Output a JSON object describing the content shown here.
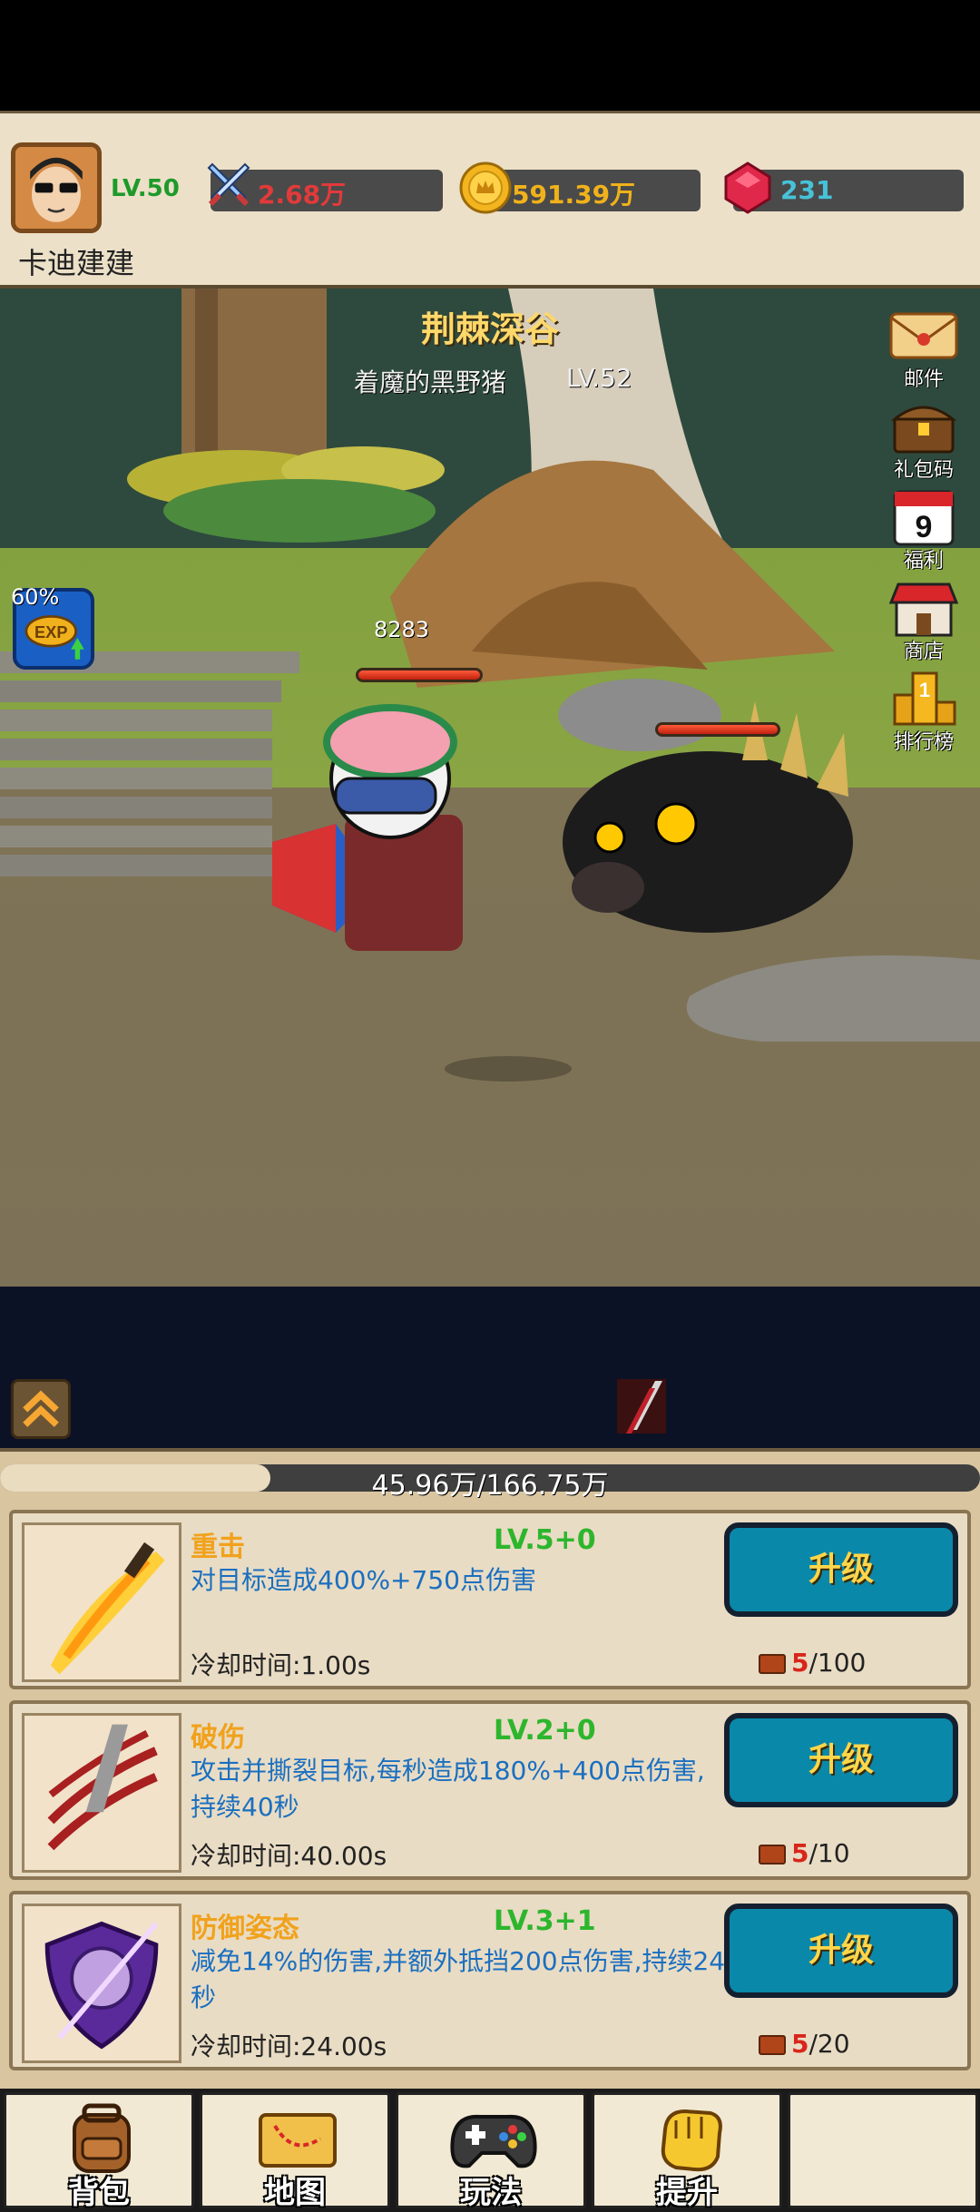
{
  "player": {
    "name": "卡迪建建",
    "level": "LV.50"
  },
  "resources": [
    {
      "icon": "crossed-swords-icon",
      "value": "2.68万",
      "color": "#e23a3a"
    },
    {
      "icon": "gold-coin-icon",
      "value": "591.39万",
      "color": "#f0b21b"
    },
    {
      "icon": "red-gem-icon",
      "value": "231",
      "color": "#47c2d8"
    }
  ],
  "battle": {
    "stage_name": "荆棘深谷",
    "enemy_name": "着魔的黑野猪",
    "enemy_level": "LV.52",
    "player_hp_value": "8283",
    "exp_percent": "60%"
  },
  "side_menu": [
    {
      "icon": "mail-icon",
      "label": "邮件"
    },
    {
      "icon": "treasure-chest-icon",
      "label": "礼包码"
    },
    {
      "icon": "calendar-icon",
      "label": "福利",
      "badge": "9"
    },
    {
      "icon": "shop-icon",
      "label": "商店"
    },
    {
      "icon": "ranking-icon",
      "label": "排行榜",
      "badge": "1"
    }
  ],
  "xp_bar": {
    "text": "45.96万/166.75万",
    "fraction": 0.276
  },
  "skills": [
    {
      "name": "重击",
      "level": "LV.5+0",
      "description": "对目标造成400%+750点伤害",
      "cooldown": "冷却时间:1.00s",
      "books_have": "5",
      "books_need": "/100",
      "button": "升级",
      "icon": "golden-blade-icon"
    },
    {
      "name": "破伤",
      "level": "LV.2+0",
      "description": "攻击并撕裂目标,每秒造成180%+400点伤害,持续40秒",
      "cooldown": "冷却时间:40.00s",
      "books_have": "5",
      "books_need": "/10",
      "button": "升级",
      "icon": "bloody-claw-icon"
    },
    {
      "name": "防御姿态",
      "level": "LV.3+1",
      "description": "减免14%的伤害,并额外抵挡200点伤害,持续24秒",
      "cooldown": "冷却时间:24.00s",
      "books_have": "5",
      "books_need": "/20",
      "button": "升级",
      "icon": "purple-shield-icon"
    }
  ],
  "bottom_nav": [
    {
      "label": "背包",
      "icon": "backpack-icon"
    },
    {
      "label": "地图",
      "icon": "map-scroll-icon"
    },
    {
      "label": "玩法",
      "icon": "gamepad-icon"
    },
    {
      "label": "提升",
      "icon": "golden-fist-icon"
    }
  ]
}
